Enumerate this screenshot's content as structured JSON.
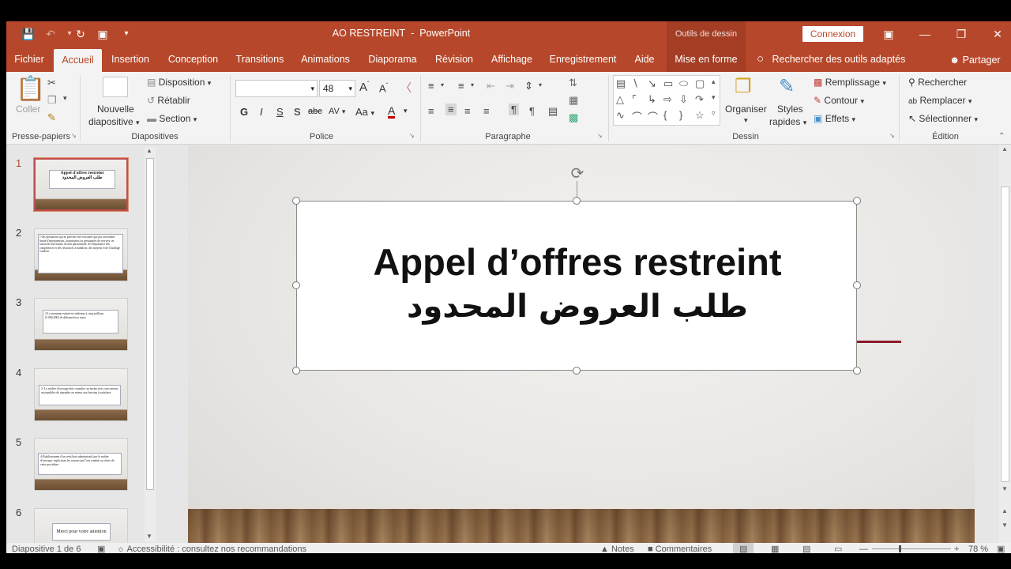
{
  "window": {
    "title": "AO RESTREINT",
    "title_sep": "-",
    "app_name": "PowerPoint",
    "contextual_tools": "Outils de dessin",
    "signin": "Connexion"
  },
  "quick_access": {
    "save_icon": "save-icon",
    "undo_icon": "undo-icon",
    "redo_icon": "repeat-icon",
    "present_icon": "present-icon",
    "more_icon": "customize-icon"
  },
  "tabs": [
    {
      "label": "Fichier"
    },
    {
      "label": "Accueil"
    },
    {
      "label": "Insertion"
    },
    {
      "label": "Conception"
    },
    {
      "label": "Transitions"
    },
    {
      "label": "Animations"
    },
    {
      "label": "Diaporama"
    },
    {
      "label": "Révision"
    },
    {
      "label": "Affichage"
    },
    {
      "label": "Enregistrement"
    },
    {
      "label": "Aide"
    },
    {
      "label": "Mise en forme"
    }
  ],
  "search_tools": "Rechercher des outils adaptés",
  "share": "Partager",
  "ribbon": {
    "clipboard": {
      "label": "Presse-papiers",
      "paste": "Coller"
    },
    "slides": {
      "label": "Diapositives",
      "new_slide_1": "Nouvelle",
      "new_slide_2": "diapositive",
      "layout": "Disposition",
      "reset": "Rétablir",
      "section": "Section"
    },
    "font": {
      "label": "Police",
      "font_name": "",
      "font_size": "48",
      "bold": "G",
      "italic": "I",
      "underline": "S",
      "shadow": "S",
      "strike": "abc",
      "spacing": "AV",
      "case": "Aa",
      "color_a": "A",
      "grow": "A",
      "shrink": "A"
    },
    "paragraph": {
      "label": "Paragraphe"
    },
    "drawing": {
      "label": "Dessin",
      "arrange": "Organiser",
      "quick_styles_1": "Styles",
      "quick_styles_2": "rapides",
      "fill": "Remplissage",
      "outline": "Contour",
      "effects": "Effets"
    },
    "editing": {
      "label": "Édition",
      "find": "Rechercher",
      "replace": "Remplacer",
      "select": "Sélectionner"
    }
  },
  "thumbnails": [
    {
      "num": "1",
      "title": "Appel d'offres restreint",
      "subtitle": "طلب العروض المحدود"
    },
    {
      "num": "2",
      "text": "1-des prestations qui ne peuvent être exécutées que par un nombre limité d'entrepreneurs, fournisseurs ou prestataires de services, en raison de leur nature, de leur particularité, de l'importance des compétences et des ressources à mobiliser, des moyens et de l'outillage à utiliser"
    },
    {
      "num": "3",
      "text": "2-Le montant estimé est inférieur à cinq millions (5.000.000) de dirhams hors taxes"
    },
    {
      "num": "4",
      "text": "3- Le maître d'ouvrage doit consulter au moins trois concurrents susceptibles de répondre au mieux aux besoins à satisfaire."
    },
    {
      "num": "5",
      "text": "4-Établissement d'un certificat administratif par le maître d'ouvrage, explicitant les raisons qui l'ont conduit au choix de cette procédure"
    },
    {
      "num": "6",
      "text": "Merci pour votre attention"
    }
  ],
  "slide": {
    "title": "Appel d’offres restreint",
    "title_ar": "طلب العروض المحدود"
  },
  "status": {
    "slide_info": "Diapositive 1 de 6",
    "accessibility": "Accessibilité : consultez nos recommandations",
    "notes": "Notes",
    "comments": "Commentaires",
    "zoom": "78 %"
  },
  "colors": {
    "accent": "#b7472a",
    "ribbon_bg": "#f3f3f3",
    "font_color_bar": "#c00000",
    "slide_accent": "#8b1a2b"
  }
}
